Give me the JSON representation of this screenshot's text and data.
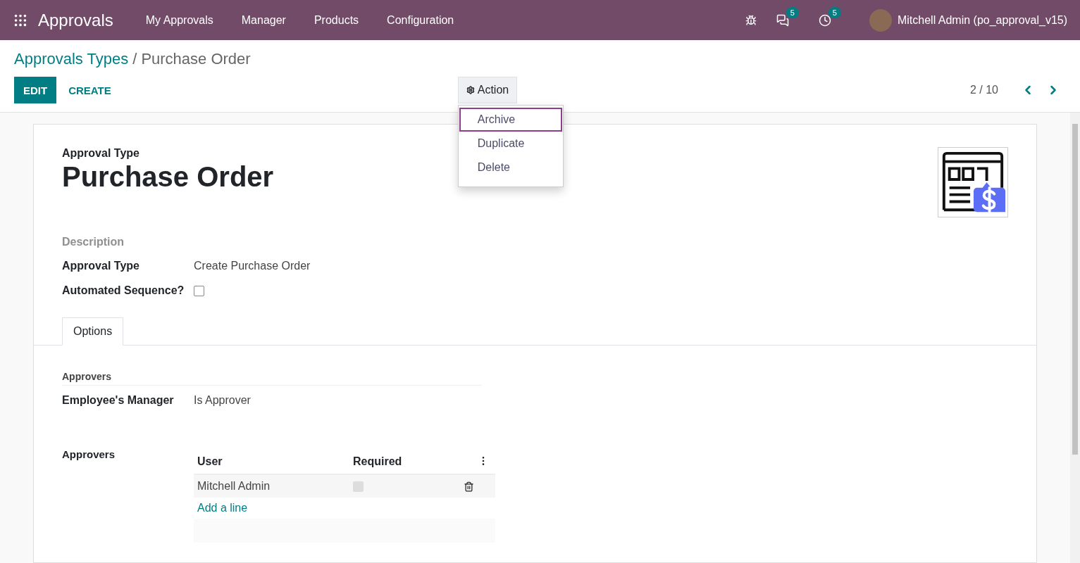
{
  "navbar": {
    "app_name": "Approvals",
    "menu": [
      "My Approvals",
      "Manager",
      "Products",
      "Configuration"
    ],
    "messages_count": "5",
    "activities_count": "5",
    "user": "Mitchell Admin (po_approval_v15)"
  },
  "breadcrumb": {
    "parent": "Approvals Types",
    "separator": "/",
    "current": "Purchase Order"
  },
  "buttons": {
    "edit": "EDIT",
    "create": "CREATE"
  },
  "action": {
    "label": "Action",
    "expanded": true,
    "items": [
      {
        "label": "Archive",
        "selected": true
      },
      {
        "label": "Duplicate",
        "selected": false
      },
      {
        "label": "Delete",
        "selected": false
      }
    ]
  },
  "pager": "2 / 10",
  "form": {
    "title_label": "Approval Type",
    "title": "Purchase Order",
    "description_label": "Description",
    "fields": [
      {
        "kind": "text",
        "label": "Approval Type",
        "value": "Create Purchase Order"
      },
      {
        "kind": "checkbox",
        "label": "Automated Sequence?",
        "checked": false
      }
    ],
    "tabs": [
      {
        "label": "Options",
        "selected": true
      }
    ],
    "approvers_section": "Approvers",
    "manager_field": {
      "label": "Employee's Manager",
      "value": "Is Approver"
    },
    "approvers_label": "Approvers",
    "table": {
      "columns": [
        "User",
        "Required"
      ],
      "rows": [
        {
          "user": "Mitchell Admin",
          "required": false
        }
      ],
      "add_line": "Add a line"
    }
  }
}
